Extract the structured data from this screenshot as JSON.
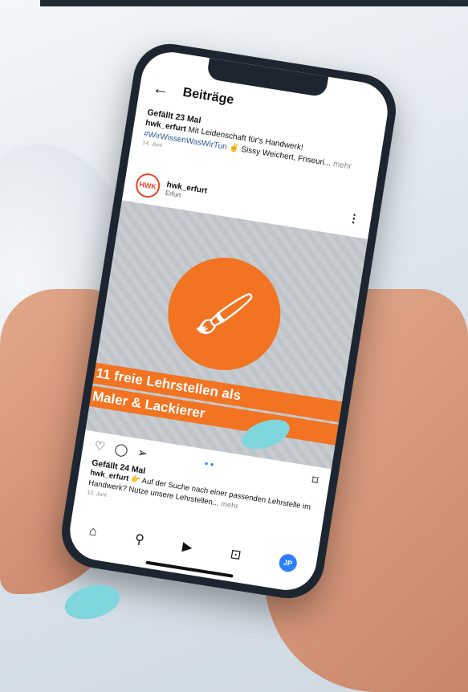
{
  "header": {
    "title": "Beiträge",
    "back_icon": "arrow-left-icon"
  },
  "post1": {
    "likes": "Gefällt 23 Mal",
    "user": "hwk_erfurt",
    "caption": "Mit Leidenschaft für's Handwerk!",
    "hashtag": "#WirWissenWasWirTun",
    "caption_tail": "✌ Sissy Weichert, Friseuri...",
    "more": "mehr",
    "date": "14. Juni"
  },
  "author": {
    "avatar": "HWK",
    "name": "hwk_erfurt",
    "location": "Erfurt"
  },
  "image": {
    "line1": "11 freie Lehrstellen als",
    "line2": "Maler & Lackierer",
    "accent": "#f27321"
  },
  "actions": {
    "like": "♡",
    "comment": "◯",
    "share": "➢",
    "dots": "● ●",
    "save": "⌑"
  },
  "post2": {
    "likes": "Gefällt 24 Mal",
    "user": "hwk_erfurt",
    "caption": "👉 Auf der Suche nach einer passenden Lehrstelle im Handwerk? Nutze unsere Lehrstellen...",
    "more": "mehr",
    "date": "12. Juni"
  },
  "tabbar": {
    "home": "⌂",
    "search": "⚲",
    "reels": "▶",
    "shop": "⊡",
    "me": "JP"
  }
}
